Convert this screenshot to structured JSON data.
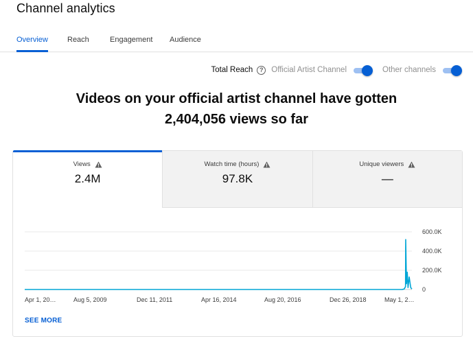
{
  "page_title": "Channel analytics",
  "tabs": [
    {
      "label": "Overview",
      "active": true
    },
    {
      "label": "Reach",
      "active": false
    },
    {
      "label": "Engagement",
      "active": false
    },
    {
      "label": "Audience",
      "active": false
    }
  ],
  "reach_bar": {
    "total_reach_label": "Total Reach",
    "help_icon": "question-mark-circle-icon",
    "toggles": [
      {
        "label": "Official Artist Channel",
        "on": true
      },
      {
        "label": "Other channels",
        "on": true
      }
    ]
  },
  "headline": {
    "line1": "Videos on your official artist channel have gotten",
    "line2": "2,404,056 views so far"
  },
  "metrics": [
    {
      "label": "Views",
      "value": "2.4M",
      "active": true,
      "icon": "warning-triangle-icon"
    },
    {
      "label": "Watch time (hours)",
      "value": "97.8K",
      "active": false,
      "icon": "warning-triangle-icon"
    },
    {
      "label": "Unique viewers",
      "value": "—",
      "active": false,
      "icon": "warning-triangle-icon"
    }
  ],
  "colors": {
    "accent": "#065fd4",
    "line": "#00a6d6"
  },
  "chart_data": {
    "type": "line",
    "series": [
      {
        "x": [
          0,
          0.97,
          0.975,
          0.98,
          0.9835,
          0.984,
          0.986,
          0.988,
          0.99,
          0.993,
          0.997,
          1.0
        ],
        "values": [
          0,
          0,
          500,
          5000,
          30000,
          520000,
          60000,
          180000,
          20000,
          130000,
          20000,
          5000
        ]
      }
    ],
    "x_tick_labels": [
      "Apr 1, 20…",
      "Aug 5, 2009",
      "Dec 11, 2011",
      "Apr 16, 2014",
      "Aug 20, 2016",
      "Dec 26, 2018",
      "May 1, 2…"
    ],
    "y_ticks": [
      0,
      200000,
      400000,
      600000
    ],
    "y_tick_labels": [
      "0",
      "200.0K",
      "400.0K",
      "600.0K"
    ],
    "ylim": [
      0,
      600000
    ],
    "grid": true,
    "y_axis_side": "right"
  },
  "see_more_label": "SEE MORE"
}
